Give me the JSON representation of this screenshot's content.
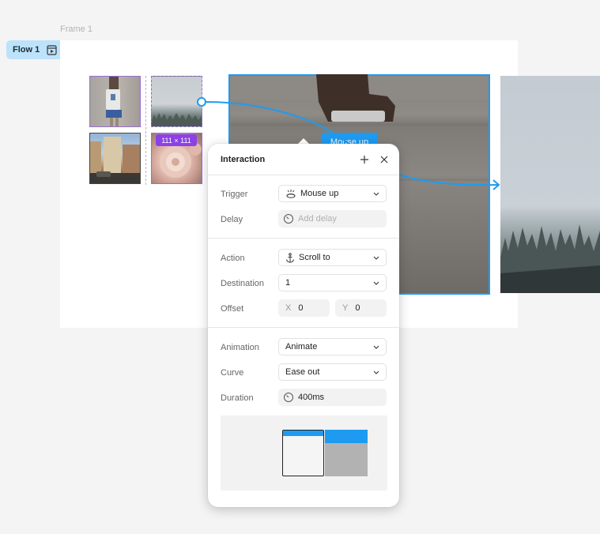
{
  "canvas": {
    "frame_label": "Frame 1",
    "flow_label": "Flow 1",
    "size_badge": "111 × 111",
    "hotspot_label": "Mouse up"
  },
  "panel": {
    "title": "Interaction",
    "trigger": {
      "label": "Trigger",
      "value": "Mouse up"
    },
    "delay": {
      "label": "Delay",
      "placeholder": "Add delay"
    },
    "action": {
      "label": "Action",
      "value": "Scroll to"
    },
    "destination": {
      "label": "Destination",
      "value": "1"
    },
    "offset": {
      "label": "Offset",
      "x_axis": "X",
      "x_value": "0",
      "y_axis": "Y",
      "y_value": "0"
    },
    "animation": {
      "label": "Animation",
      "value": "Animate"
    },
    "curve": {
      "label": "Curve",
      "value": "Ease out"
    },
    "duration": {
      "label": "Duration",
      "value": "400ms"
    }
  },
  "colors": {
    "accent": "#1e9bf0",
    "selection": "#8c41e6",
    "flow_badge_bg": "#bde3fb"
  },
  "icons": [
    "flow-play-icon",
    "plus-icon",
    "close-icon",
    "mouse-up-icon",
    "timer-icon",
    "anchor-icon",
    "chevron-down-icon"
  ]
}
